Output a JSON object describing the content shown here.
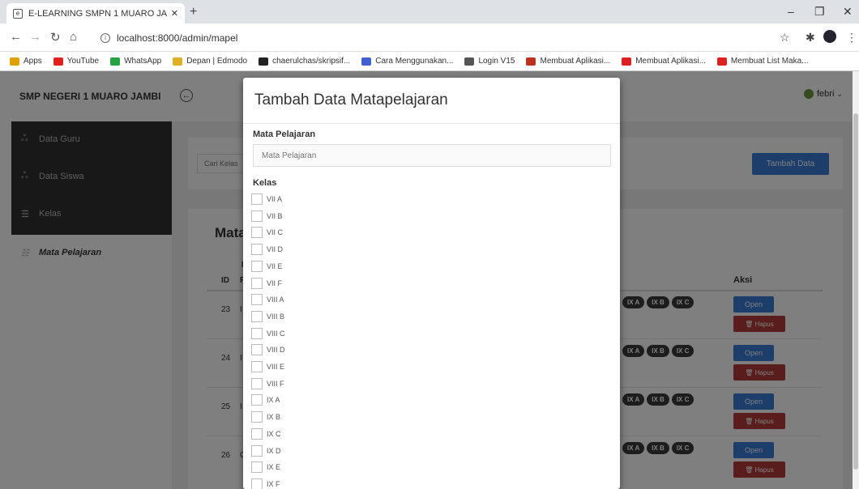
{
  "browser": {
    "tab_title": "E-LEARNING SMPN 1 MUARO JA",
    "url": "localhost:8000/admin/mapel",
    "bookmarks": [
      {
        "label": "Apps",
        "color": "#e0a000"
      },
      {
        "label": "YouTube",
        "color": "#e02020"
      },
      {
        "label": "WhatsApp",
        "color": "#25a244"
      },
      {
        "label": "Depan | Edmodo",
        "color": "#e0b020"
      },
      {
        "label": "chaerulchas/skripsif...",
        "color": "#222222"
      },
      {
        "label": "Cara Menggunakan...",
        "color": "#4060d0"
      },
      {
        "label": "Login V15",
        "color": "#555555"
      },
      {
        "label": "Membuat Aplikasi...",
        "color": "#c03020"
      },
      {
        "label": "Membuat Aplikasi...",
        "color": "#e02020"
      },
      {
        "label": "Membuat List Maka...",
        "color": "#e02020"
      }
    ]
  },
  "app": {
    "brand": "SMP NEGERI 1 MUARO JAMBI",
    "user": "febri",
    "sidebar": [
      {
        "label": "Data Guru",
        "icon": "users-icon"
      },
      {
        "label": "Data Siswa",
        "icon": "users-icon"
      },
      {
        "label": "Kelas",
        "icon": "list-icon"
      },
      {
        "label": "Mata Pelajaran",
        "icon": "database-icon"
      }
    ],
    "search_placeholder": "Cari Kelas",
    "add_button": "Tambah Data",
    "section_title": "Mata",
    "table": {
      "col_id": "ID",
      "col_m": "M",
      "col_p": "P",
      "col_aksi": "Aksi",
      "rows": [
        {
          "id": "23",
          "initial": "I"
        },
        {
          "id": "24",
          "initial": "I"
        },
        {
          "id": "25",
          "initial": "I"
        },
        {
          "id": "26",
          "initial": "C"
        }
      ],
      "pills": [
        "IX A",
        "IX B",
        "IX C"
      ],
      "open_label": "Open",
      "hapus_label": "🗑 Hapus"
    }
  },
  "modal": {
    "title": "Tambah Data Matapelajaran",
    "mapel_label": "Mata Pelajaran",
    "mapel_placeholder": "Mata Pelajaran",
    "kelas_label": "Kelas",
    "kelas": [
      "VII A",
      "VII B",
      "VII C",
      "VII D",
      "VII E",
      "VII F",
      "VIII A",
      "VIII B",
      "VIII C",
      "VIII D",
      "VIII E",
      "VIII F",
      "IX A",
      "IX B",
      "IX C",
      "IX D",
      "IX E",
      "IX F"
    ]
  }
}
